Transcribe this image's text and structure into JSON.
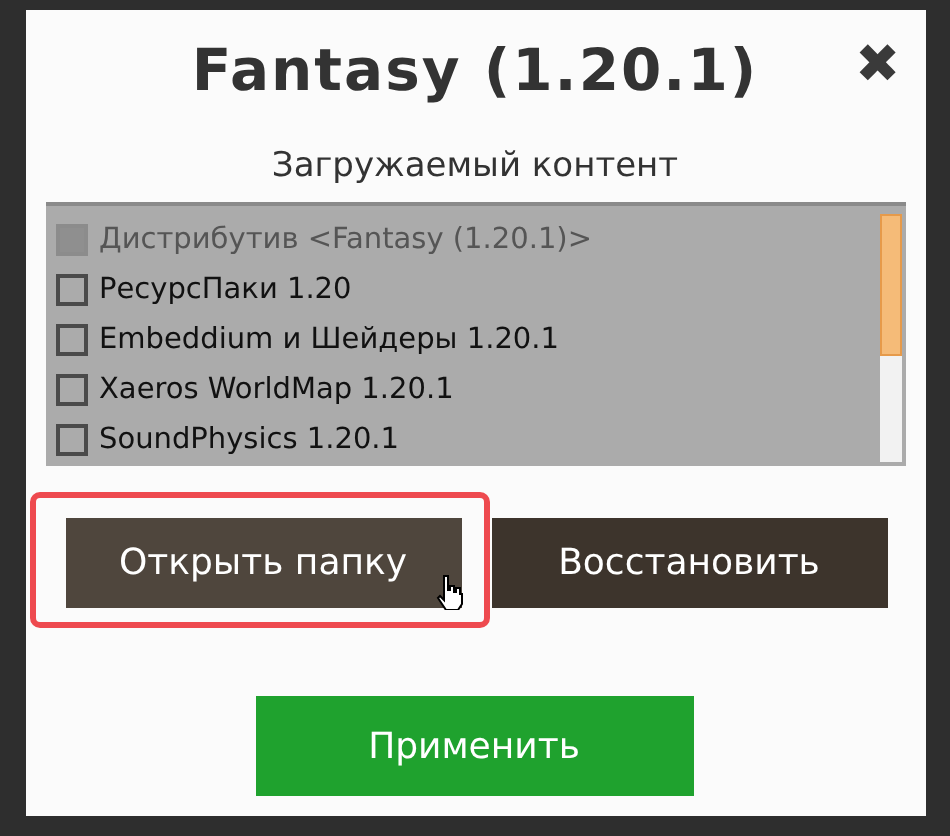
{
  "dialog": {
    "title": "Fantasy (1.20.1)",
    "close": "✖"
  },
  "content": {
    "heading": "Загружаемый контент",
    "items": [
      {
        "label": "Дистрибутив <Fantasy (1.20.1)>",
        "checked": true,
        "disabled": true
      },
      {
        "label": "РесурсПаки 1.20",
        "checked": false,
        "disabled": false
      },
      {
        "label": "Embeddium и Шейдеры 1.20.1",
        "checked": false,
        "disabled": false
      },
      {
        "label": "Xaeros WorldMap 1.20.1",
        "checked": false,
        "disabled": false
      },
      {
        "label": "SoundPhysics 1.20.1",
        "checked": false,
        "disabled": false
      }
    ]
  },
  "buttons": [
    {
      "label": "Открыть папку",
      "kind": "secondary",
      "highlighted": true
    },
    {
      "label": "Восстановить",
      "kind": "secondary",
      "highlighted": false
    },
    {
      "label": "Применить",
      "kind": "primary",
      "highlighted": false
    }
  ]
}
